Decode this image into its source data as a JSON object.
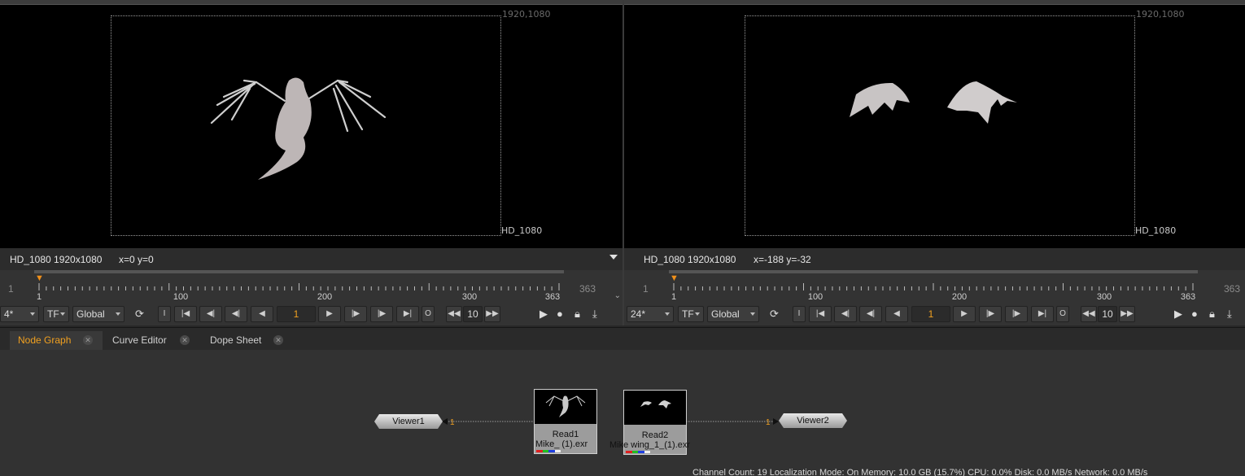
{
  "viewers": [
    {
      "format_corner": "1920,1080",
      "format_name": "HD_1080",
      "info_format": "HD_1080 1920x1080",
      "info_coord": "x=0 y=0",
      "timeline": {
        "start": "1",
        "end": "363",
        "ticks": [
          "1",
          "100",
          "200",
          "300",
          "363"
        ],
        "playhead": "1"
      },
      "controls": {
        "fps": "4*",
        "tf": "TF",
        "global": "Global",
        "frame": "1",
        "step": "10",
        "in": "I",
        "out": "O"
      }
    },
    {
      "format_corner": "1920,1080",
      "format_name": "HD_1080",
      "info_format": "HD_1080 1920x1080",
      "info_coord": "x=-188 y=-32",
      "timeline": {
        "start": "1",
        "end": "363",
        "ticks": [
          "1",
          "100",
          "200",
          "300",
          "363"
        ],
        "playhead": "1"
      },
      "controls": {
        "fps": "24*",
        "tf": "TF",
        "global": "Global",
        "frame": "1",
        "step": "10",
        "in": "I",
        "out": "O"
      }
    }
  ],
  "tabs": [
    {
      "label": "Node Graph",
      "active": true
    },
    {
      "label": "Curve Editor",
      "active": false
    },
    {
      "label": "Dope Sheet",
      "active": false
    }
  ],
  "nodes": {
    "viewer1": "Viewer1",
    "viewer2": "Viewer2",
    "read1": {
      "name": "Read1",
      "file": "Mike_ (1).exr"
    },
    "read2": {
      "name": "Read2",
      "file": "Mike wing_1_(1).exr"
    },
    "input1": "1",
    "input2": "1"
  },
  "status": "Channel Count: 19  Localization Mode: On  Memory: 10.0 GB (15.7%)  CPU: 0.0%  Disk: 0.0 MB/s  Network: 0.0 MB/s",
  "colors": {
    "accent": "#f0a020",
    "background": "#282828",
    "viewer_bg": "#000000"
  }
}
